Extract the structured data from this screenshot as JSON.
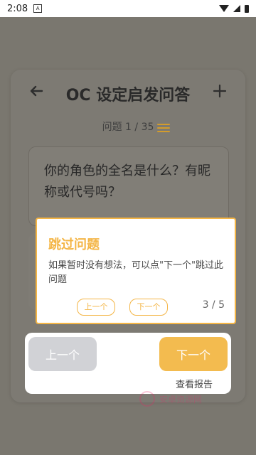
{
  "status": {
    "time": "2:08",
    "badge": "A"
  },
  "header": {
    "title": "OC 设定启发问答",
    "progress": "问题 1 / 35"
  },
  "question": {
    "text": "你的角色的全名是什么？有昵称或代号吗？"
  },
  "popup": {
    "title": "跳过问题",
    "description": "如果暂时没有想法，可以点\"下一个\"跳过此问题",
    "prev": "上一个",
    "next": "下一个",
    "step": "3 / 5"
  },
  "bottom": {
    "prev": "上一个",
    "next": "下一个",
    "report": "查看报告"
  },
  "watermark": {
    "text": "安卓资源网"
  },
  "colors": {
    "accent": "#f4b545",
    "disabled": "#d1d2d6",
    "overlay": "#7a776f"
  }
}
